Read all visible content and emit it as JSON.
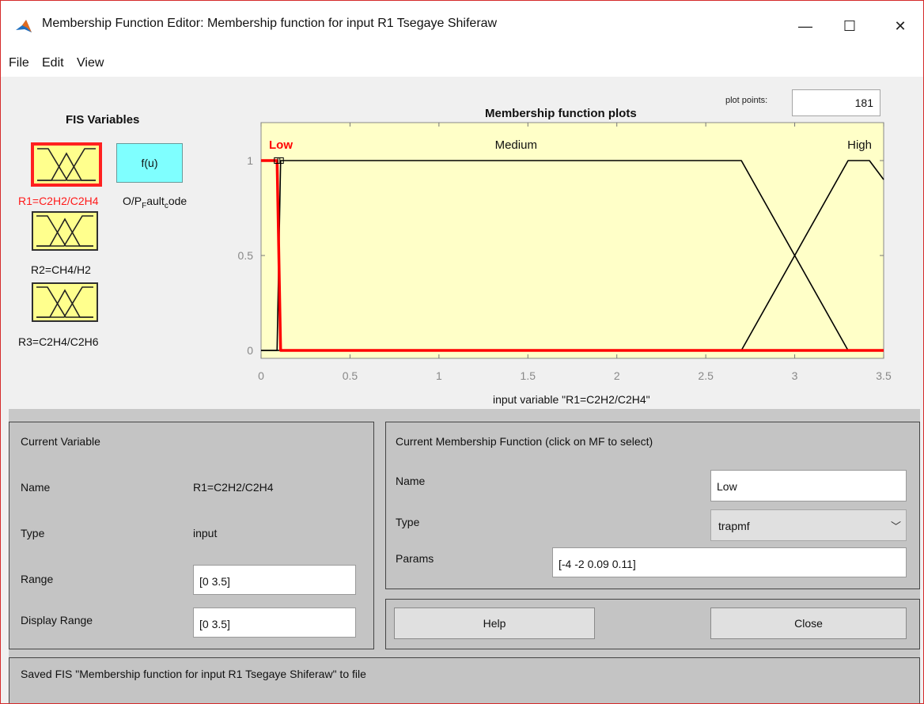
{
  "window": {
    "title": "Membership Function Editor: Membership function for input R1 Tsegaye Shiferaw",
    "minimize": "—",
    "maximize": "☐",
    "close": "✕"
  },
  "menu": [
    "File",
    "Edit",
    "View"
  ],
  "fis": {
    "title": "FIS Variables",
    "inputs": [
      {
        "label": "R1=C2H2/C2H4",
        "selected": true
      },
      {
        "label": "R2=CH4/H2",
        "selected": false
      },
      {
        "label": "R3=C2H4/C2H6",
        "selected": false
      }
    ],
    "output": {
      "box_text": "f(u)",
      "label_main": "O/P",
      "label_sub1": "F",
      "label_mid": "ault",
      "label_sub2": "c",
      "label_end": "ode"
    }
  },
  "plot": {
    "title": "Membership function plots",
    "plot_points_label": "plot points:",
    "plot_points": "181",
    "xlabel": "input variable \"R1=C2H2/C2H4\""
  },
  "chart_data": {
    "type": "line",
    "title": "Membership function plots",
    "xlabel": "input variable \"R1=C2H2/C2H4\"",
    "ylabel": "",
    "xlim": [
      0,
      3.5
    ],
    "ylim": [
      0,
      1
    ],
    "xticks": [
      "0",
      "0.5",
      "1",
      "1.5",
      "2",
      "2.5",
      "3",
      "3.5"
    ],
    "yticks": [
      "0",
      "0.5",
      "1"
    ],
    "series": [
      {
        "name": "Low",
        "selected": true,
        "color": "#ff0000",
        "x": [
          0,
          0.09,
          0.11,
          3.5
        ],
        "y": [
          1,
          1,
          0,
          0
        ]
      },
      {
        "name": "Medium",
        "selected": false,
        "color": "#000000",
        "x": [
          0,
          0.09,
          0.11,
          2.7,
          3.3,
          3.5
        ],
        "y": [
          0,
          0,
          1,
          1,
          0,
          0
        ]
      },
      {
        "name": "High",
        "selected": false,
        "color": "#000000",
        "x": [
          0,
          2.7,
          3.3,
          3.42,
          3.5
        ],
        "y": [
          0,
          0,
          1,
          1,
          0.9
        ]
      }
    ],
    "handles": [
      0.09,
      0.11
    ],
    "background": "#ffffc8"
  },
  "current_variable": {
    "title": "Current Variable",
    "name_label": "Name",
    "name_value": "R1=C2H2/C2H4",
    "type_label": "Type",
    "type_value": "input",
    "range_label": "Range",
    "range_value": "[0 3.5]",
    "display_range_label": "Display Range",
    "display_range_value": "[0 3.5]"
  },
  "current_mf": {
    "title": "Current Membership Function (click on MF to select)",
    "name_label": "Name",
    "name_value": "Low",
    "type_label": "Type",
    "type_value": "trapmf",
    "params_label": "Params",
    "params_value": "[-4 -2 0.09 0.11]"
  },
  "buttons": {
    "help": "Help",
    "close": "Close"
  },
  "status": "Saved FIS \"Membership function for input R1 Tsegaye Shiferaw\" to file"
}
